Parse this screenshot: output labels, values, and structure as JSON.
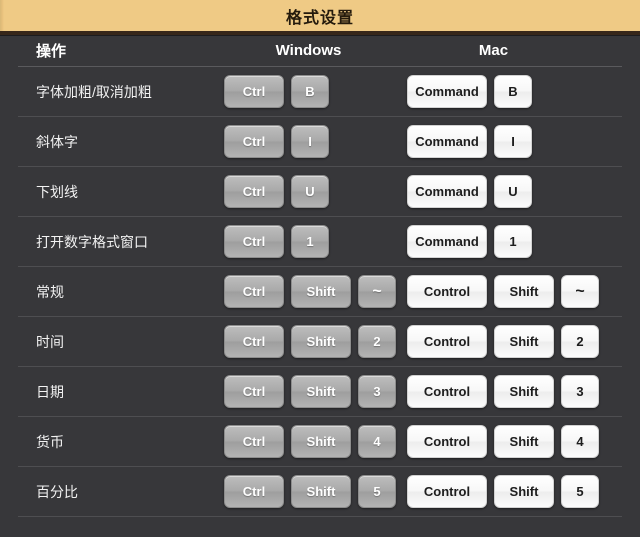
{
  "header": {
    "title": "格式设置"
  },
  "colors": {
    "title_band": "#efca85",
    "title_text": "#241a0c",
    "body_background": "#37373a",
    "windows_key": "#b0b0b0",
    "mac_key": "#ffffff",
    "row_divider": "#4e4e51"
  },
  "columns": {
    "action": "操作",
    "windows": "Windows",
    "mac": "Mac"
  },
  "rows": [
    {
      "action": "字体加粗/取消加粗",
      "windows": [
        "Ctrl",
        "B"
      ],
      "mac": [
        "Command",
        "B"
      ]
    },
    {
      "action": "斜体字",
      "windows": [
        "Ctrl",
        "I"
      ],
      "mac": [
        "Command",
        "I"
      ]
    },
    {
      "action": "下划线",
      "windows": [
        "Ctrl",
        "U"
      ],
      "mac": [
        "Command",
        "U"
      ]
    },
    {
      "action": "打开数字格式窗口",
      "windows": [
        "Ctrl",
        "1"
      ],
      "mac": [
        "Command",
        "1"
      ]
    },
    {
      "action": "常规",
      "windows": [
        "Ctrl",
        "Shift",
        "~"
      ],
      "mac": [
        "Control",
        "Shift",
        "~"
      ]
    },
    {
      "action": "时间",
      "windows": [
        "Ctrl",
        "Shift",
        "2"
      ],
      "mac": [
        "Control",
        "Shift",
        "2"
      ]
    },
    {
      "action": "日期",
      "windows": [
        "Ctrl",
        "Shift",
        "3"
      ],
      "mac": [
        "Control",
        "Shift",
        "3"
      ]
    },
    {
      "action": "货币",
      "windows": [
        "Ctrl",
        "Shift",
        "4"
      ],
      "mac": [
        "Control",
        "Shift",
        "4"
      ]
    },
    {
      "action": "百分比",
      "windows": [
        "Ctrl",
        "Shift",
        "5"
      ],
      "mac": [
        "Control",
        "Shift",
        "5"
      ]
    }
  ]
}
